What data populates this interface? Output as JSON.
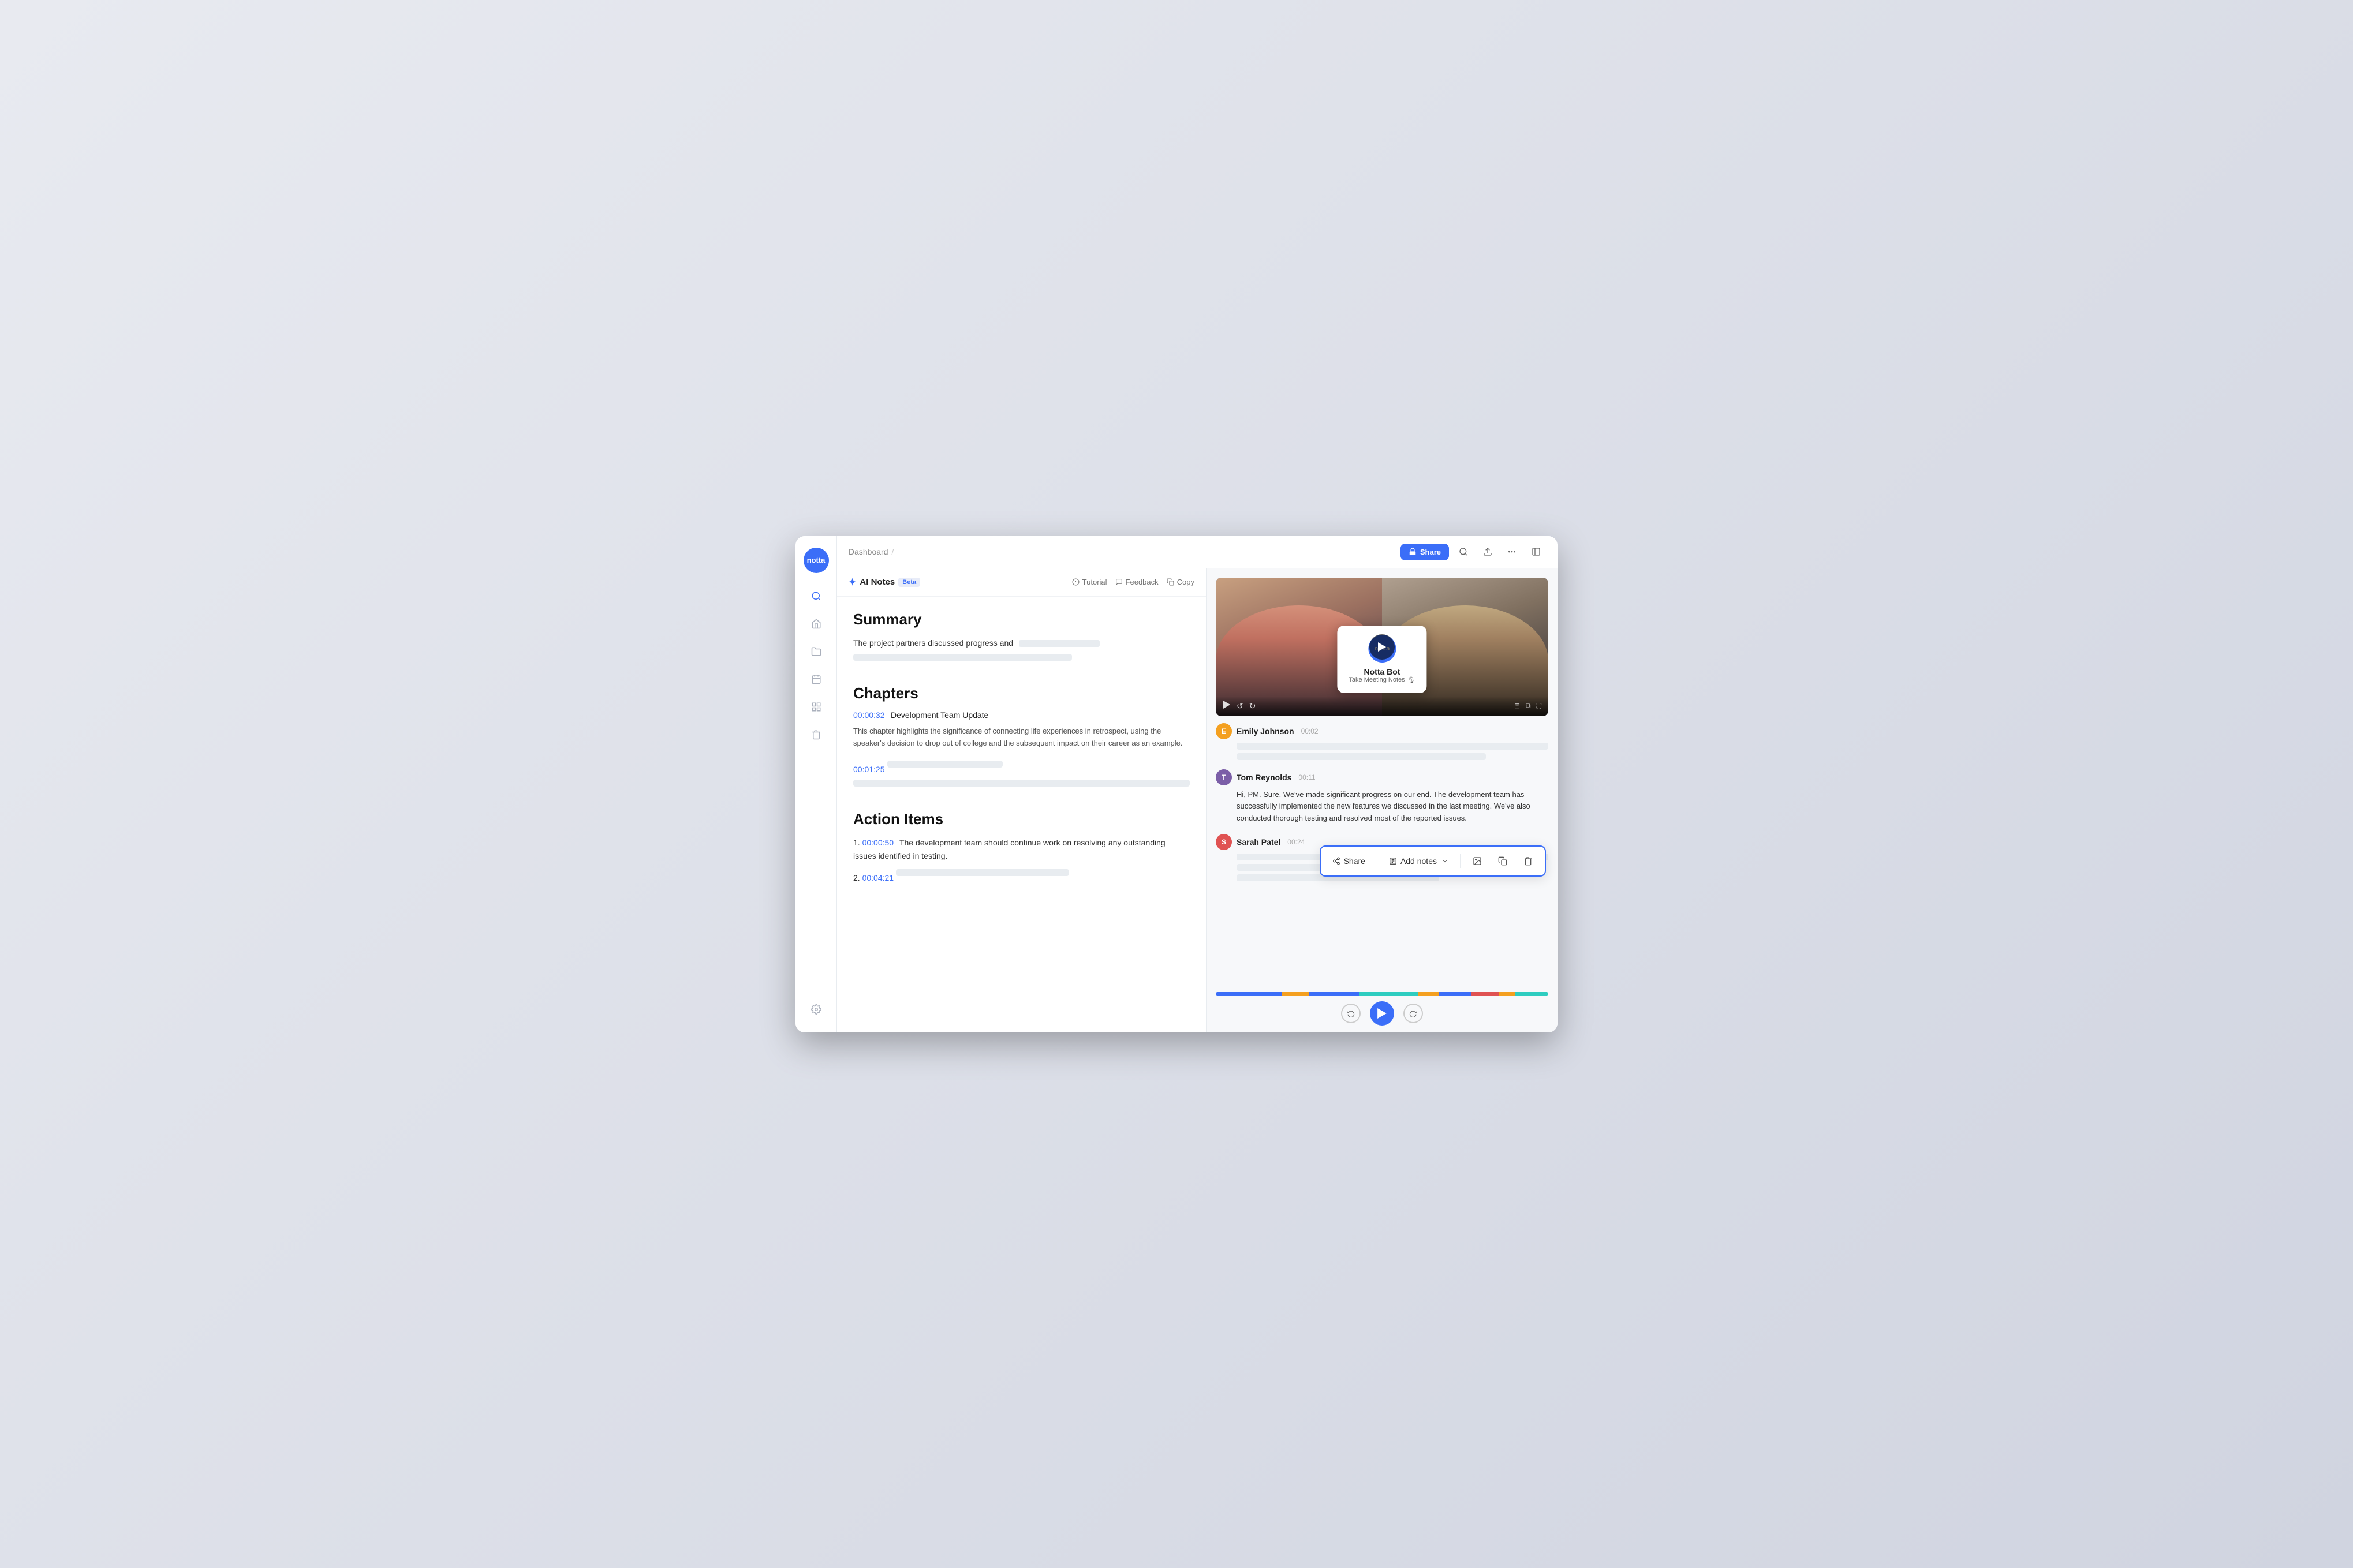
{
  "app": {
    "logo_text": "notta",
    "window_title": "Notta AI Notes"
  },
  "header": {
    "breadcrumb": "Dashboard",
    "breadcrumb_sep": "/",
    "share_button": "Share",
    "lock_icon": "🔒"
  },
  "sidebar": {
    "logo": "notta",
    "icons": [
      {
        "name": "search",
        "symbol": "🔍",
        "id": "search-icon"
      },
      {
        "name": "home",
        "symbol": "⌂",
        "id": "home-icon"
      },
      {
        "name": "folder",
        "symbol": "🗂",
        "id": "folder-icon"
      },
      {
        "name": "calendar",
        "symbol": "📅",
        "id": "calendar-icon"
      },
      {
        "name": "list",
        "symbol": "📋",
        "id": "list-icon"
      },
      {
        "name": "trash",
        "symbol": "🗑",
        "id": "trash-icon"
      }
    ],
    "settings_icon": "⚙"
  },
  "ai_notes_bar": {
    "title": "AI Notes",
    "beta_label": "Beta",
    "tutorial": "Tutorial",
    "feedback": "Feedback",
    "copy": "Copy",
    "ai_icon": "✦"
  },
  "left_panel": {
    "summary": {
      "heading": "Summary",
      "text_start": "The  project partners discussed progress and"
    },
    "chapters": {
      "heading": "Chapters",
      "items": [
        {
          "time": "00:00:32",
          "name": "Development Team Update",
          "description": "This chapter highlights the significance of connecting life experiences in retrospect, using the speaker's decision to drop out of college and the subsequent impact on their career as an example."
        },
        {
          "time": "00:01:25",
          "name": ""
        }
      ]
    },
    "action_items": {
      "heading": "Action Items",
      "items": [
        {
          "number": "1.",
          "time": "00:00:50",
          "text": "The development team should continue work on resolving any outstanding issues identified in testing."
        },
        {
          "number": "2.",
          "time": "00:04:21",
          "text": ""
        }
      ]
    }
  },
  "transcript": {
    "entries": [
      {
        "id": "emily",
        "name": "Emily Johnson",
        "time": "00:02",
        "avatar_color": "#f4a020",
        "avatar_letter": "E",
        "text": ""
      },
      {
        "id": "tom",
        "name": "Tom Reynolds",
        "time": "00:11",
        "avatar_color": "#7b5ea7",
        "avatar_letter": "T",
        "text": "Hi, PM. Sure. We've made significant progress on our end. The development team has successfully implemented the new features we discussed in the last meeting. We've also conducted thorough testing and resolved most of the reported issues."
      },
      {
        "id": "sarah",
        "name": "Sarah Patel",
        "time": "00:24",
        "avatar_color": "#e05252",
        "avatar_letter": "S",
        "text": ""
      }
    ]
  },
  "action_popup": {
    "share_label": "Share",
    "add_notes_label": "Add notes",
    "share_icon": "↗",
    "add_notes_icon": "📋",
    "image_icon": "🖼",
    "copy_icon": "⧉",
    "delete_icon": "🗑"
  },
  "video_player": {
    "notta_bot_name": "Notta Bot",
    "notta_bot_sub": "Take Meeting Notes",
    "notta_logo": "notta"
  },
  "progress_bar": {
    "segments": [
      {
        "color": "#3b6ef8",
        "width": "20%"
      },
      {
        "color": "#f4a020",
        "width": "8%"
      },
      {
        "color": "#3b6ef8",
        "width": "15%"
      },
      {
        "color": "#2ecdc0",
        "width": "18%"
      },
      {
        "color": "#f4a020",
        "width": "6%"
      },
      {
        "color": "#3b6ef8",
        "width": "10%"
      },
      {
        "color": "#e05252",
        "width": "8%"
      },
      {
        "color": "#f4a020",
        "width": "5%"
      },
      {
        "color": "#2ecdc0",
        "width": "10%"
      }
    ]
  }
}
